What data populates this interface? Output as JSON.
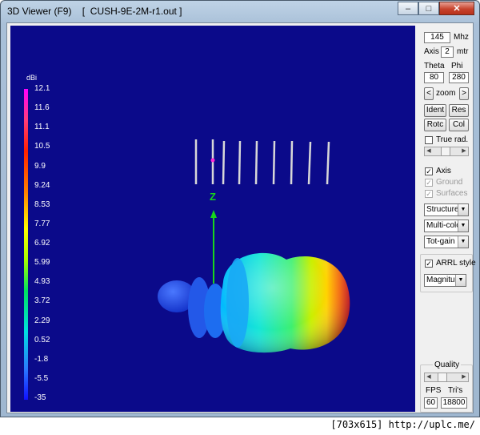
{
  "window": {
    "title": "3D Viewer (F9)    [  CUSH-9E-2M-r1.out ]",
    "minimize_label": "–",
    "maximize_label": "□",
    "close_label": "✕"
  },
  "scale": {
    "unit": "dBi",
    "ticks": [
      "12.1",
      "11.6",
      "11.1",
      "10.5",
      "9.9",
      "9.24",
      "8.53",
      "7.77",
      "6.92",
      "5.99",
      "4.93",
      "3.72",
      "2.29",
      "0.52",
      "-1.8",
      "-5.5",
      "-35"
    ]
  },
  "axis_label": "Z",
  "controls": {
    "freq_value": "145",
    "freq_unit": "Mhz",
    "axis_label": "Axis",
    "axis_value": "2",
    "axis_unit": "mtr",
    "theta_label": "Theta",
    "phi_label": "Phi",
    "theta_value": "80",
    "phi_value": "280",
    "zoom_left": "<",
    "zoom_label": "zoom",
    "zoom_right": ">",
    "ident_label": "Ident",
    "res_label": "Res",
    "rotc_label": "Rotc",
    "col_label": "Col",
    "true_rad_label": "True rad.",
    "true_rad_checked": false,
    "true_rad_slider": 0.4,
    "axis_check_label": "Axis",
    "axis_checked": true,
    "ground_label": "Ground",
    "ground_checked": true,
    "surfaces_label": "Surfaces",
    "surfaces_checked": true,
    "structure_select": "Structure",
    "color_select": "Multi-colo",
    "gain_select": "Tot-gain",
    "arrl_label": "ARRL style",
    "arrl_checked": true,
    "magnitude_select": "Magnitude",
    "quality_label": "Quality",
    "quality_slider": 0.35,
    "fps_label": "FPS",
    "tris_label": "Tri's",
    "fps_value": "60",
    "tris_value": "18800"
  },
  "footer": "[703x615] http://uplc.me/",
  "colors": {
    "viewport_bg": "#0b0a8a",
    "axis_green": "#17d61c",
    "element_color": "#d8d8d8",
    "feed_point": "#ff2bd6"
  }
}
